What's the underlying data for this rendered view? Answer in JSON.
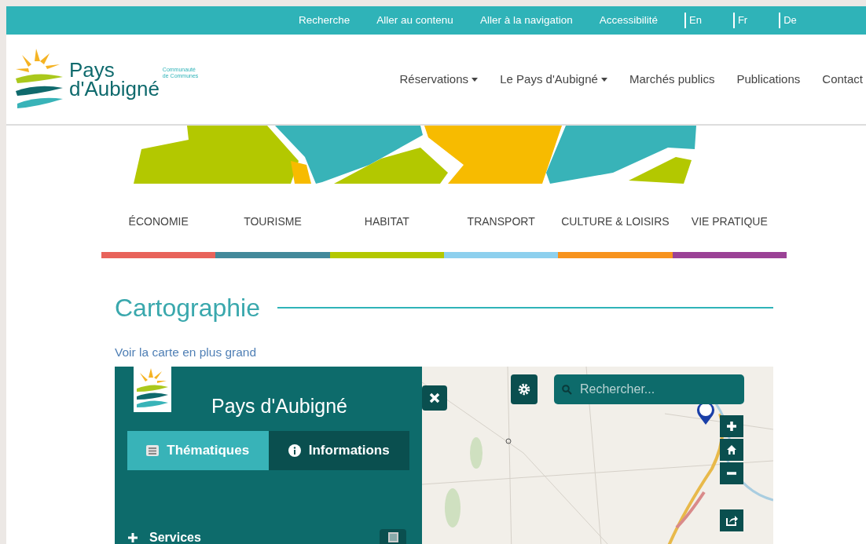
{
  "topbar": {
    "links": [
      "Recherche",
      "Aller au contenu",
      "Aller à la navigation",
      "Accessibilité"
    ],
    "languages": [
      "En",
      "Fr",
      "De"
    ]
  },
  "logo": {
    "name_line1": "Pays",
    "name_line2": "d'Aubigné",
    "tagline1": "Communauté",
    "tagline2": "de Communes"
  },
  "nav": [
    {
      "label": "Réservations",
      "kind": "dropdown"
    },
    {
      "label": "Le Pays d'Aubigné",
      "kind": "dropdown"
    },
    {
      "label": "Marchés publics",
      "kind": "link"
    },
    {
      "label": "Publications",
      "kind": "link"
    },
    {
      "label": "Contact",
      "kind": "link"
    }
  ],
  "categories": [
    {
      "label": "ÉCONOMIE",
      "color": "#e8635a"
    },
    {
      "label": "TOURISME",
      "color": "#43899a"
    },
    {
      "label": "HABITAT",
      "color": "#b3c800"
    },
    {
      "label": "TRANSPORT",
      "color": "#8dd0ee"
    },
    {
      "label": "CULTURE & LOISIRS",
      "color": "#f7931e"
    },
    {
      "label": "VIE PRATIQUE",
      "color": "#9b4296"
    }
  ],
  "section": {
    "title": "Cartographie",
    "link": "Voir la carte en plus grand"
  },
  "map": {
    "panel_title": "Pays d'Aubigné",
    "tabs": [
      {
        "label": "Thématiques",
        "selected": true,
        "kind": "list"
      },
      {
        "label": "Informations",
        "selected": false,
        "kind": "info"
      }
    ],
    "layers": [
      {
        "label": "Services",
        "expanded": false,
        "checked": false
      }
    ],
    "search": {
      "placeholder": "Rechercher..."
    }
  }
}
